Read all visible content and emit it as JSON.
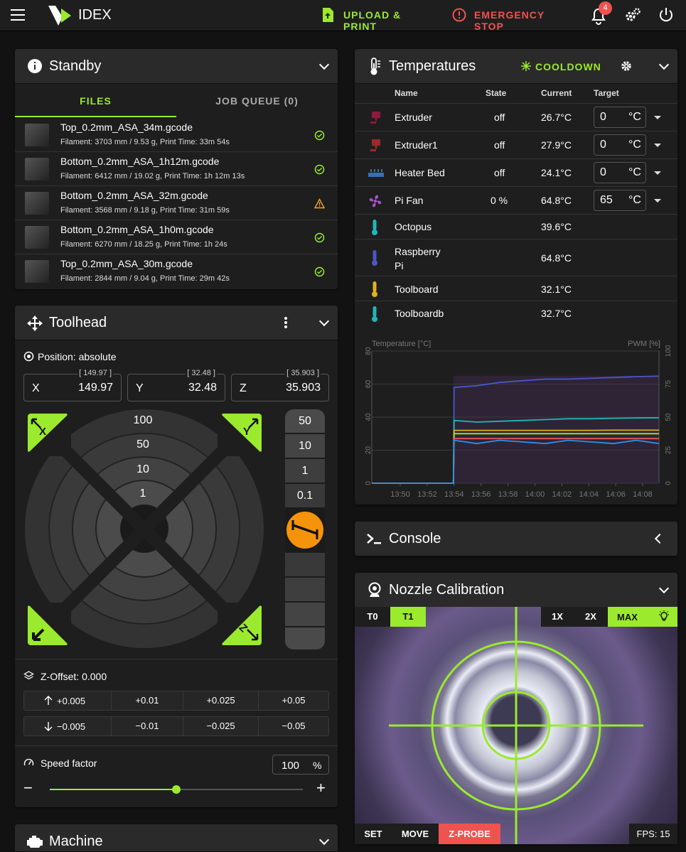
{
  "topbar": {
    "app_title": "IDEX",
    "upload_label": "UPLOAD & PRINT",
    "emergency_label": "EMERGENCY STOP",
    "notif_count": "4"
  },
  "standby": {
    "title": "Standby",
    "tabs": [
      "FILES",
      "JOB QUEUE (0)"
    ],
    "files": [
      {
        "name": "Top_0.2mm_ASA_34m.gcode",
        "info": "Filament: 3703 mm / 9.53 g, Print Time: 33m 54s",
        "status": "ok"
      },
      {
        "name": "Bottom_0.2mm_ASA_1h12m.gcode",
        "info": "Filament: 6412 mm / 19.02 g, Print Time: 1h 12m 13s",
        "status": "ok"
      },
      {
        "name": "Bottom_0.2mm_ASA_32m.gcode",
        "info": "Filament: 3568 mm / 9.18 g, Print Time: 31m 59s",
        "status": "warn"
      },
      {
        "name": "Bottom_0.2mm_ASA_1h0m.gcode",
        "info": "Filament: 6270 mm / 18.25 g, Print Time: 1h 24s",
        "status": "ok"
      },
      {
        "name": "Top_0.2mm_ASA_30m.gcode",
        "info": "Filament: 2844 mm / 9.04 g, Print Time: 29m 42s",
        "status": "ok"
      }
    ]
  },
  "toolhead": {
    "title": "Toolhead",
    "position_label": "Position: absolute",
    "axes": [
      {
        "label": "X",
        "value": "149.97",
        "set": "[ 149.97 ]"
      },
      {
        "label": "Y",
        "value": "32.48",
        "set": "[ 32.48 ]"
      },
      {
        "label": "Z",
        "value": "35.903",
        "set": "[ 35.903 ]"
      }
    ],
    "xy_steps": [
      "100",
      "50",
      "10",
      "1"
    ],
    "z_steps": [
      "50",
      "10",
      "1",
      "0.1"
    ],
    "zoffset_label": "Z-Offset: 0.000",
    "zoffset_up": [
      "+0.005",
      "+0.01",
      "+0.025",
      "+0.05"
    ],
    "zoffset_down": [
      "−0.005",
      "−0.01",
      "−0.025",
      "−0.05"
    ],
    "speed_label": "Speed factor",
    "speed_value": "100",
    "speed_unit": "%",
    "speed_fraction": 0.5
  },
  "machine": {
    "title": "Machine"
  },
  "temperatures": {
    "title": "Temperatures",
    "cooldown_label": "COOLDOWN",
    "columns": [
      "Name",
      "State",
      "Current",
      "Target"
    ],
    "rows": [
      {
        "name": "Extruder",
        "state": "off",
        "current": "26.7°C",
        "target": "0",
        "unit": "°C",
        "icon_color": "#8b1a3c"
      },
      {
        "name": "Extruder1",
        "state": "off",
        "current": "27.9°C",
        "target": "0",
        "unit": "°C",
        "icon_color": "#9b2a2a"
      },
      {
        "name": "Heater Bed",
        "state": "off",
        "current": "24.1°C",
        "target": "0",
        "unit": "°C",
        "icon_color": "#3d6bb5"
      },
      {
        "name": "Pi Fan",
        "state": "0 %",
        "current": "64.8°C",
        "target": "65",
        "unit": "°C",
        "icon_color": "#a855c7"
      },
      {
        "name": "Octopus",
        "state": "",
        "current": "39.6°C",
        "icon_color": "#1fb7b7"
      },
      {
        "name": "Raspberry Pi",
        "state": "",
        "current": "64.8°C",
        "icon_color": "#4a56c9"
      },
      {
        "name": "Toolboard",
        "state": "",
        "current": "32.1°C",
        "icon_color": "#e2b01c"
      },
      {
        "name": "Toolboardb",
        "state": "",
        "current": "32.7°C",
        "icon_color": "#1fb7b7"
      }
    ]
  },
  "chart_data": {
    "type": "line",
    "ylabel": "Temperature [°C]",
    "y2label": "PWM [%]",
    "ylim": [
      0,
      80
    ],
    "y2lim": [
      0,
      100
    ],
    "y_ticks": [
      "0",
      "20",
      "40",
      "60",
      "80"
    ],
    "y2_ticks": [
      "0",
      "25",
      "50",
      "75",
      "100"
    ],
    "x_ticks": [
      "13:50",
      "13:52",
      "13:54",
      "13:56",
      "13:58",
      "14:00",
      "14:02",
      "14:04",
      "14:06",
      "14:08"
    ],
    "grid": true,
    "series": [
      {
        "color": "#4a56c9",
        "values": [
          0,
          0,
          58,
          59,
          61,
          62,
          63,
          63,
          63.5,
          64,
          64.5,
          64.8
        ]
      },
      {
        "color": "#1fb7b7",
        "values": [
          0,
          0,
          38,
          37,
          37.5,
          38,
          38.5,
          39,
          39,
          39.3,
          39.5,
          39.6
        ]
      },
      {
        "color": "#e2b01c",
        "values": [
          0,
          0,
          32,
          32,
          32,
          32,
          32,
          32,
          32,
          32.1,
          32.1,
          32.1
        ]
      },
      {
        "color": "#9bea2e",
        "values": [
          0,
          0,
          30,
          30,
          30,
          30,
          30,
          30,
          30,
          30,
          30,
          30
        ]
      },
      {
        "color": "#ef5350",
        "values": [
          0,
          0,
          27,
          27,
          27,
          27,
          27,
          27,
          27,
          27,
          27,
          27
        ]
      },
      {
        "color": "#2f8fe8",
        "values": [
          0,
          0,
          26,
          24,
          26,
          25,
          24,
          26,
          25,
          24,
          26,
          24
        ]
      }
    ]
  },
  "console": {
    "title": "Console"
  },
  "nozzle": {
    "title": "Nozzle Calibration",
    "tools": [
      "T0",
      "T1"
    ],
    "zoom": [
      "1X",
      "2X",
      "MAX"
    ],
    "bottom_buttons": [
      "SET",
      "MOVE",
      "Z-PROBE"
    ],
    "fps": "FPS: 15"
  }
}
